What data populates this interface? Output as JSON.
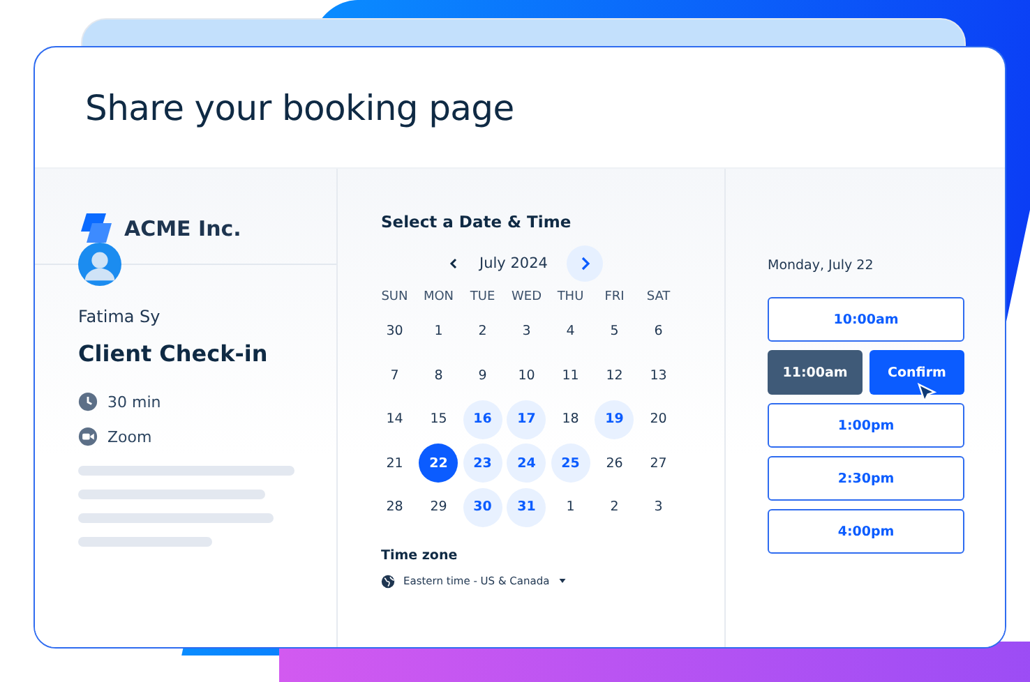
{
  "title": "Share your booking page",
  "organizer": {
    "company": "ACME Inc.",
    "host": "Fatima Sy",
    "event": "Client Check-in",
    "details": [
      {
        "kind": "duration",
        "text": "30 min"
      },
      {
        "kind": "video",
        "text": "Zoom"
      }
    ]
  },
  "calendar": {
    "heading": "Select a Date & Time",
    "month": "July 2024",
    "weekdays": [
      "SUN",
      "MON",
      "TUE",
      "WED",
      "THU",
      "FRI",
      "SAT"
    ],
    "days": [
      {
        "label": "30",
        "available": false,
        "selected": false
      },
      {
        "label": "1",
        "available": false,
        "selected": false
      },
      {
        "label": "2",
        "available": false,
        "selected": false
      },
      {
        "label": "3",
        "available": false,
        "selected": false
      },
      {
        "label": "4",
        "available": false,
        "selected": false
      },
      {
        "label": "5",
        "available": false,
        "selected": false
      },
      {
        "label": "6",
        "available": false,
        "selected": false
      },
      {
        "label": "7",
        "available": false,
        "selected": false
      },
      {
        "label": "8",
        "available": false,
        "selected": false
      },
      {
        "label": "9",
        "available": false,
        "selected": false
      },
      {
        "label": "10",
        "available": false,
        "selected": false
      },
      {
        "label": "11",
        "available": false,
        "selected": false
      },
      {
        "label": "12",
        "available": false,
        "selected": false
      },
      {
        "label": "13",
        "available": false,
        "selected": false
      },
      {
        "label": "14",
        "available": false,
        "selected": false
      },
      {
        "label": "15",
        "available": false,
        "selected": false
      },
      {
        "label": "16",
        "available": true,
        "selected": false
      },
      {
        "label": "17",
        "available": true,
        "selected": false
      },
      {
        "label": "18",
        "available": false,
        "selected": false
      },
      {
        "label": "19",
        "available": true,
        "selected": false
      },
      {
        "label": "20",
        "available": false,
        "selected": false
      },
      {
        "label": "21",
        "available": false,
        "selected": false
      },
      {
        "label": "22",
        "available": true,
        "selected": true
      },
      {
        "label": "23",
        "available": true,
        "selected": false
      },
      {
        "label": "24",
        "available": true,
        "selected": false
      },
      {
        "label": "25",
        "available": true,
        "selected": false
      },
      {
        "label": "26",
        "available": false,
        "selected": false
      },
      {
        "label": "27",
        "available": false,
        "selected": false
      },
      {
        "label": "28",
        "available": false,
        "selected": false
      },
      {
        "label": "29",
        "available": false,
        "selected": false
      },
      {
        "label": "30",
        "available": true,
        "selected": false
      },
      {
        "label": "31",
        "available": true,
        "selected": false
      },
      {
        "label": "1",
        "available": false,
        "selected": false
      },
      {
        "label": "2",
        "available": false,
        "selected": false
      },
      {
        "label": "3",
        "available": false,
        "selected": false
      }
    ],
    "timezone_label": "Time zone",
    "timezone": "Eastern time - US & Canada"
  },
  "times": {
    "date": "Monday, July 22",
    "confirm": "Confirm",
    "slots": [
      {
        "label": "10:00am",
        "selected": false
      },
      {
        "label": "11:00am",
        "selected": true
      },
      {
        "label": "1:00pm",
        "selected": false
      },
      {
        "label": "2:30pm",
        "selected": false
      },
      {
        "label": "4:00pm",
        "selected": false
      }
    ]
  }
}
